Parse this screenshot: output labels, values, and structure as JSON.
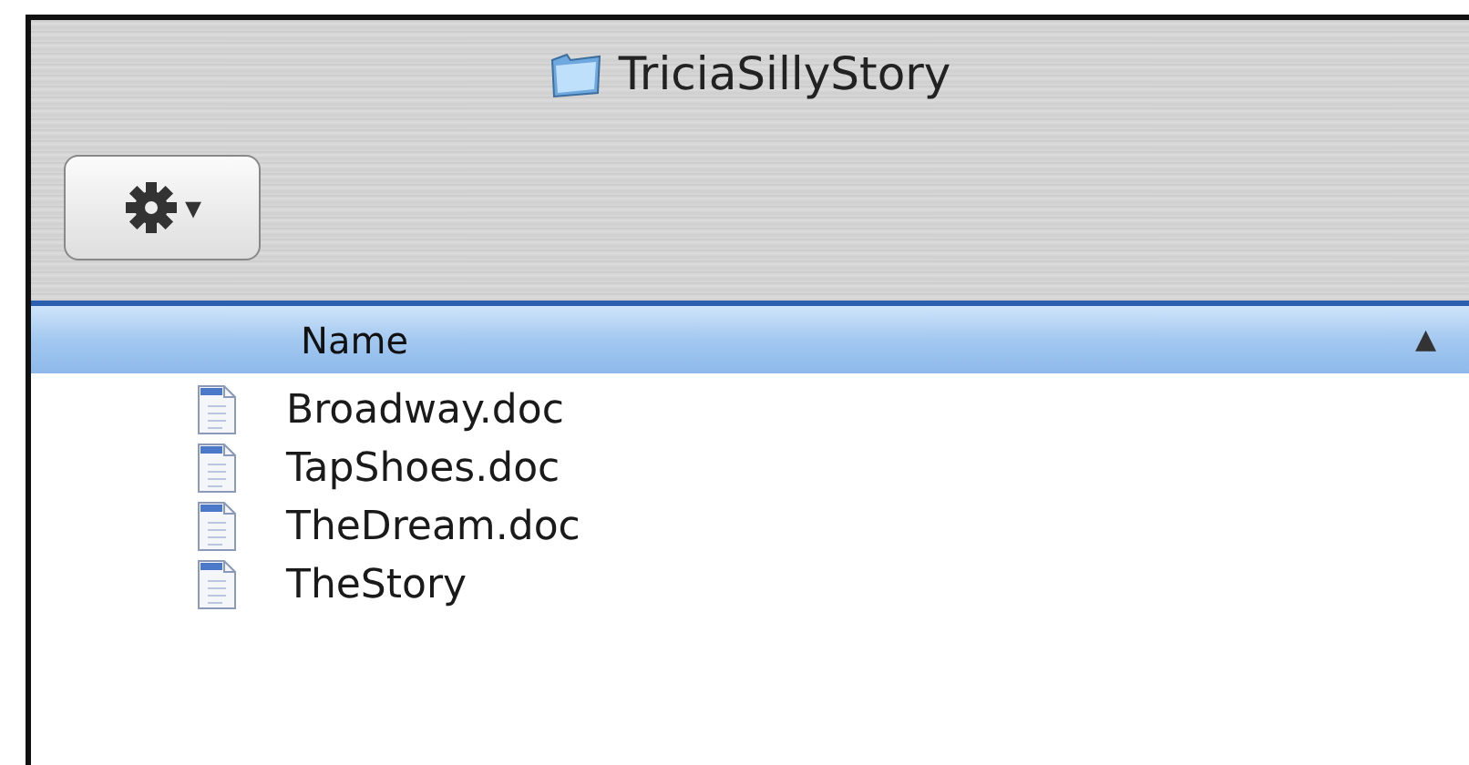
{
  "window": {
    "title": "TriciaSillyStory"
  },
  "toolbar": {
    "action_button": {
      "label": "▾"
    }
  },
  "table": {
    "columns": [
      {
        "label": "Name",
        "sort_indicator": "▲"
      }
    ],
    "rows": [
      {
        "name": "Broadway.doc"
      },
      {
        "name": "TapShoes.doc"
      },
      {
        "name": "TheDream.doc"
      },
      {
        "name": "TheStory"
      }
    ]
  }
}
